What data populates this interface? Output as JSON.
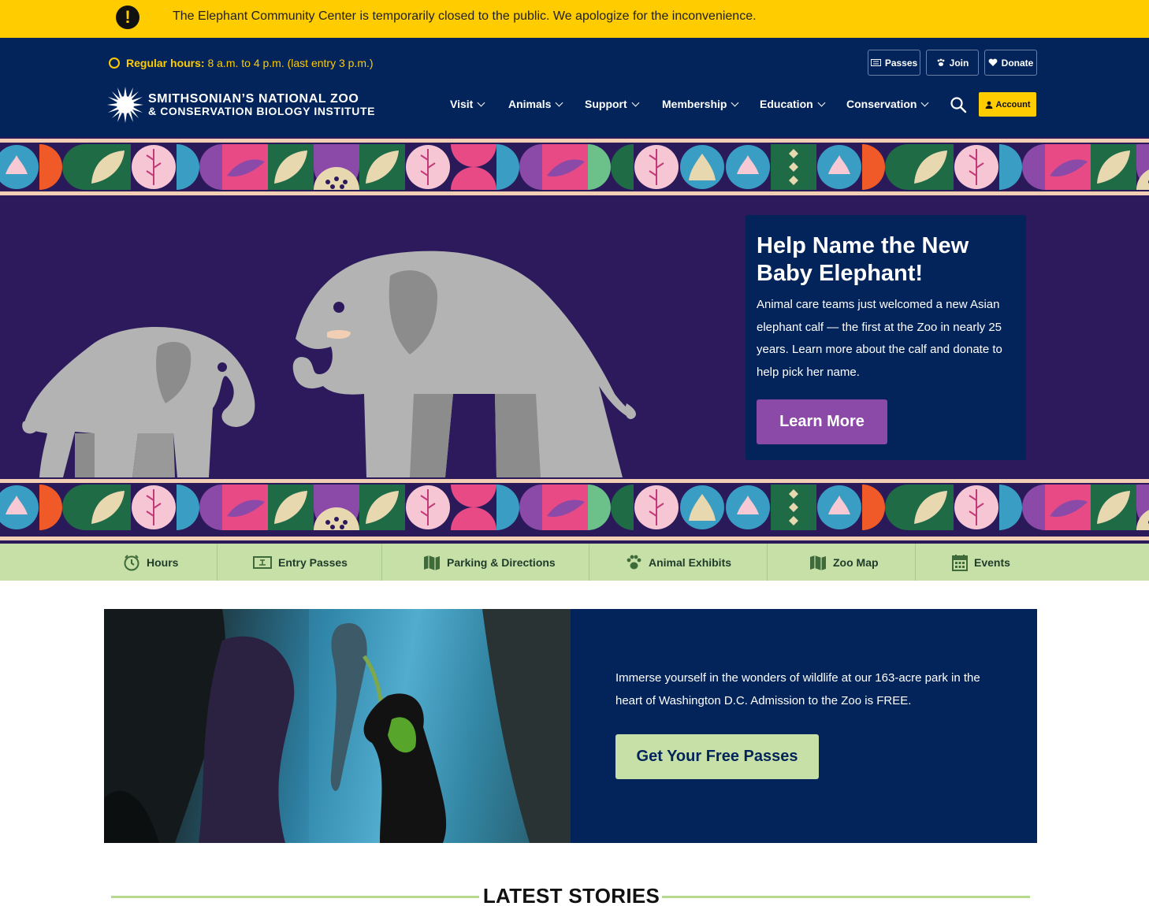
{
  "alert": {
    "icon": "exclamation-icon",
    "glyph": "!",
    "text": "The Elephant Community Center is temporarily closed to the public. We apologize for the inconvenience."
  },
  "header": {
    "hours_label": "Regular hours:",
    "hours_value": "8 a.m. to 4 p.m. (last entry 3 p.m.)",
    "utility": {
      "passes": "Passes",
      "join": "Join",
      "donate": "Donate"
    },
    "logo": {
      "line1": "SMITHSONIAN’S NATIONAL ZOO",
      "line2": "& CONSERVATION BIOLOGY INSTITUTE"
    },
    "nav": [
      "Visit",
      "Animals",
      "Support",
      "Membership",
      "Education",
      "Conservation"
    ],
    "account": "Account"
  },
  "hero": {
    "title": "Help Name the New Baby Elephant!",
    "body": "Animal care teams just welcomed a new Asian elephant calf — the first at the Zoo in nearly 25 years. Learn more about the calf and donate to help pick her name.",
    "cta": "Learn More"
  },
  "quick_links": [
    {
      "label": "Hours",
      "icon": "clock-icon"
    },
    {
      "label": "Entry Passes",
      "icon": "ticket-icon"
    },
    {
      "label": "Parking & Directions",
      "icon": "map-icon"
    },
    {
      "label": "Animal Exhibits",
      "icon": "paw-icon"
    },
    {
      "label": "Zoo Map",
      "icon": "map-icon"
    },
    {
      "label": "Events",
      "icon": "calendar-icon"
    }
  ],
  "promo": {
    "body": "Immerse yourself in the wonders of wildlife at our 163-acre park in the heart of Washington D.C. Admission to the Zoo is FREE.",
    "cta": "Get Your Free Passes"
  },
  "latest": {
    "heading": "LATEST STORIES"
  },
  "colors": {
    "alert": "#ffcc00",
    "navy": "#03245a",
    "hero_purple": "#2c1a5c",
    "accent_purple": "#8b4aa8",
    "quick_green": "#c6e0a7"
  }
}
